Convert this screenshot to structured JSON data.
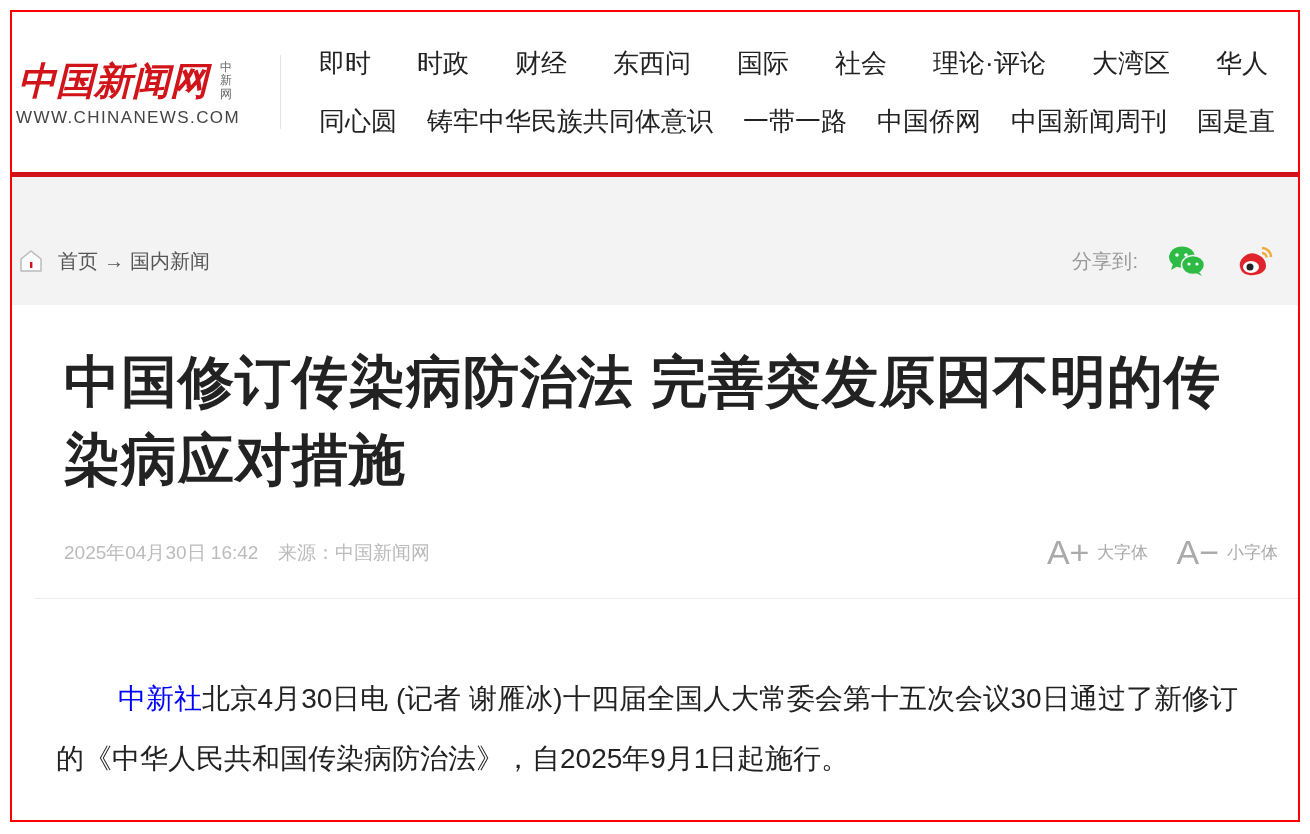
{
  "logo": {
    "name": "中国新闻网",
    "side": "中新网",
    "url": "WWW.CHINANEWS.COM"
  },
  "nav_rows": [
    [
      "即时",
      "时政",
      "财经",
      "东西问",
      "国际",
      "社会",
      "理论·评论",
      "大湾区",
      "华人"
    ],
    [
      "同心圆",
      "铸牢中华民族共同体意识",
      "一带一路",
      "中国侨网",
      "中国新闻周刊",
      "国是直"
    ]
  ],
  "breadcrumb": {
    "home": "首页",
    "arrow": "→",
    "section": "国内新闻"
  },
  "share": {
    "label": "分享到:"
  },
  "article": {
    "title": "中国修订传染病防治法 完善突发原因不明的传染病应对措施",
    "date": "2025年04月30日 16:42",
    "source": "来源：中国新闻网",
    "font_buttons": [
      {
        "glyph": "A+",
        "label": "大字体"
      },
      {
        "glyph": "A−",
        "label": "小字体"
      }
    ],
    "body": {
      "link": "中新社",
      "text": "北京4月30日电 (记者 谢雁冰)十四届全国人大常委会第十五次会议30日通过了新修订的《中华人民共和国传染病防治法》，自2025年9月1日起施行。"
    }
  }
}
